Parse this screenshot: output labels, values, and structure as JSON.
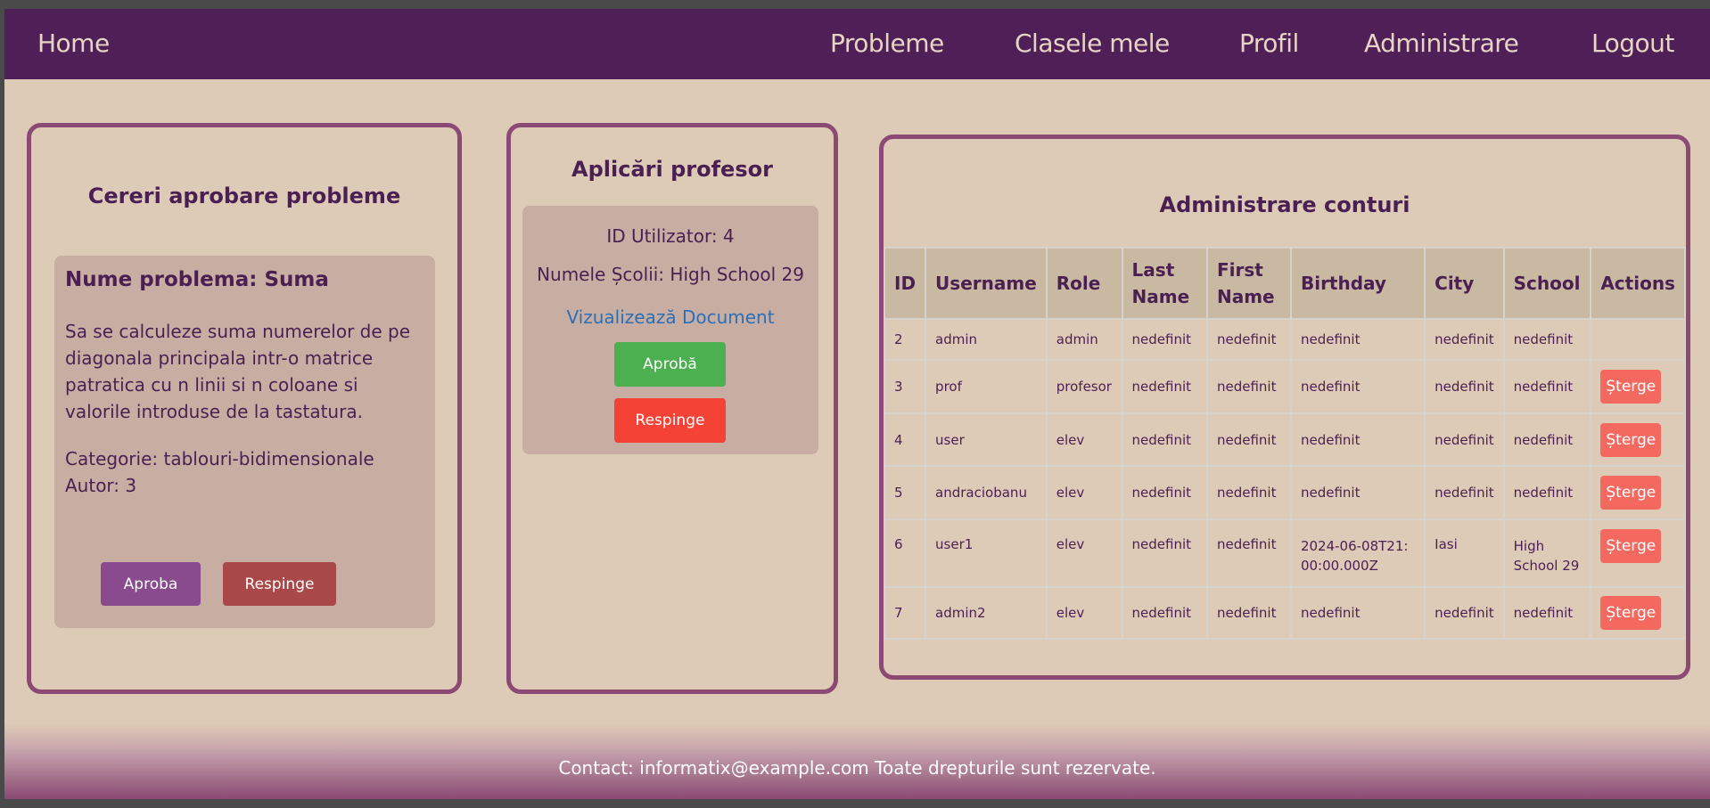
{
  "nav": {
    "home": "Home",
    "items": [
      "Probleme",
      "Clasele mele",
      "Profil",
      "Administrare",
      "Logout"
    ]
  },
  "problems": {
    "title": "Cereri aprobare probleme",
    "name": "Nume problema: Suma",
    "description": "Sa se calculeze suma numerelor de pe diagonala principala intr-o matrice patratica cu n linii si n coloane si valorile introduse de la tastatura.",
    "category": "Categorie: tablouri-bidimensionale",
    "author": "Autor: 3",
    "approve_label": "Aproba",
    "reject_label": "Respinge"
  },
  "applications": {
    "title": "Aplicări profesor",
    "user_id": "ID Utilizator: 4",
    "school": "Numele Școlii: High School 29",
    "view_document": "Vizualizează Document",
    "approve_label": "Aprobă",
    "reject_label": "Respinge"
  },
  "accounts": {
    "title": "Administrare conturi",
    "headers": [
      "ID",
      "Username",
      "Role",
      "Last Name",
      "First Name",
      "Birthday",
      "City",
      "School",
      "Actions"
    ],
    "delete_label": "Șterge",
    "rows": [
      {
        "id": "2",
        "username": "admin",
        "role": "admin",
        "last": "nedefinit",
        "first": "nedefinit",
        "birthday": "nedefinit",
        "city": "nedefinit",
        "school": "nedefinit",
        "action": ""
      },
      {
        "id": "3",
        "username": "prof",
        "role": "profesor",
        "last": "nedefinit",
        "first": "nedefinit",
        "birthday": "nedefinit",
        "city": "nedefinit",
        "school": "nedefinit",
        "action": "Șterge"
      },
      {
        "id": "4",
        "username": "user",
        "role": "elev",
        "last": "nedefinit",
        "first": "nedefinit",
        "birthday": "nedefinit",
        "city": "nedefinit",
        "school": "nedefinit",
        "action": "Șterge"
      },
      {
        "id": "5",
        "username": "andraciobanu",
        "role": "elev",
        "last": "nedefinit",
        "first": "nedefinit",
        "birthday": "nedefinit",
        "city": "nedefinit",
        "school": "nedefinit",
        "action": "Șterge"
      },
      {
        "id": "6",
        "username": "user1",
        "role": "elev",
        "last": "nedefinit",
        "first": "nedefinit",
        "birthday": "2024-06-08T21:00:00.000Z",
        "city": "Iasi",
        "school": "High School 29",
        "action": "Șterge"
      },
      {
        "id": "7",
        "username": "admin2",
        "role": "elev",
        "last": "nedefinit",
        "first": "nedefinit",
        "birthday": "nedefinit",
        "city": "nedefinit",
        "school": "nedefinit",
        "action": "Șterge"
      }
    ]
  },
  "footer": {
    "text": "Contact: informatix@example.com Toate drepturile sunt rezervate."
  },
  "colors": {
    "navbar": "#4f1f57",
    "page_bg": "#decbb7",
    "card_border": "#8a4a73",
    "approve_green": "#4caf50",
    "reject_red": "#f44336",
    "approve_purple": "#8a4a8e",
    "reject_brown": "#a84848",
    "delete_red": "#f4695f",
    "link_blue": "#2a6fb8"
  }
}
